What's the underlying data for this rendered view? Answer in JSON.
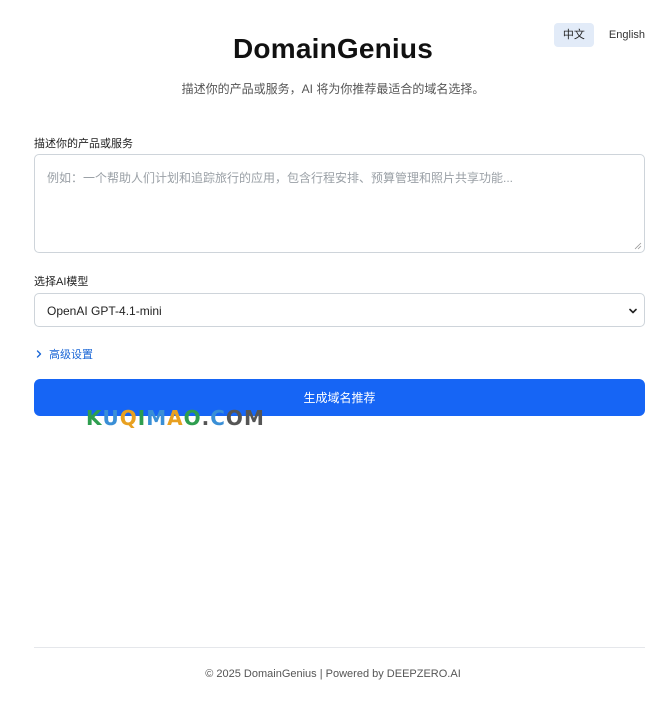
{
  "lang": {
    "zh_label": "中文",
    "en_label": "English"
  },
  "header": {
    "title": "DomainGenius",
    "subtitle": "描述你的产品或服务，AI 将为你推荐最适合的域名选择。"
  },
  "form": {
    "description_label": "描述你的产品或服务",
    "description_placeholder": "例如：一个帮助人们计划和追踪旅行的应用，包含行程安排、预算管理和照片共享功能...",
    "description_value": "",
    "model_label": "选择AI模型",
    "model_selected": "OpenAI GPT-4.1-mini",
    "advanced_label": "高级设置",
    "submit_label": "生成域名推荐"
  },
  "watermark": {
    "text": "KUQIMAO.COM"
  },
  "footer": {
    "text": "© 2025 DomainGenius | Powered by DEEPZERO.AI"
  },
  "colors": {
    "accent": "#1665f5",
    "active_lang_bg": "#e2ebf8",
    "link": "#1a66d6"
  }
}
